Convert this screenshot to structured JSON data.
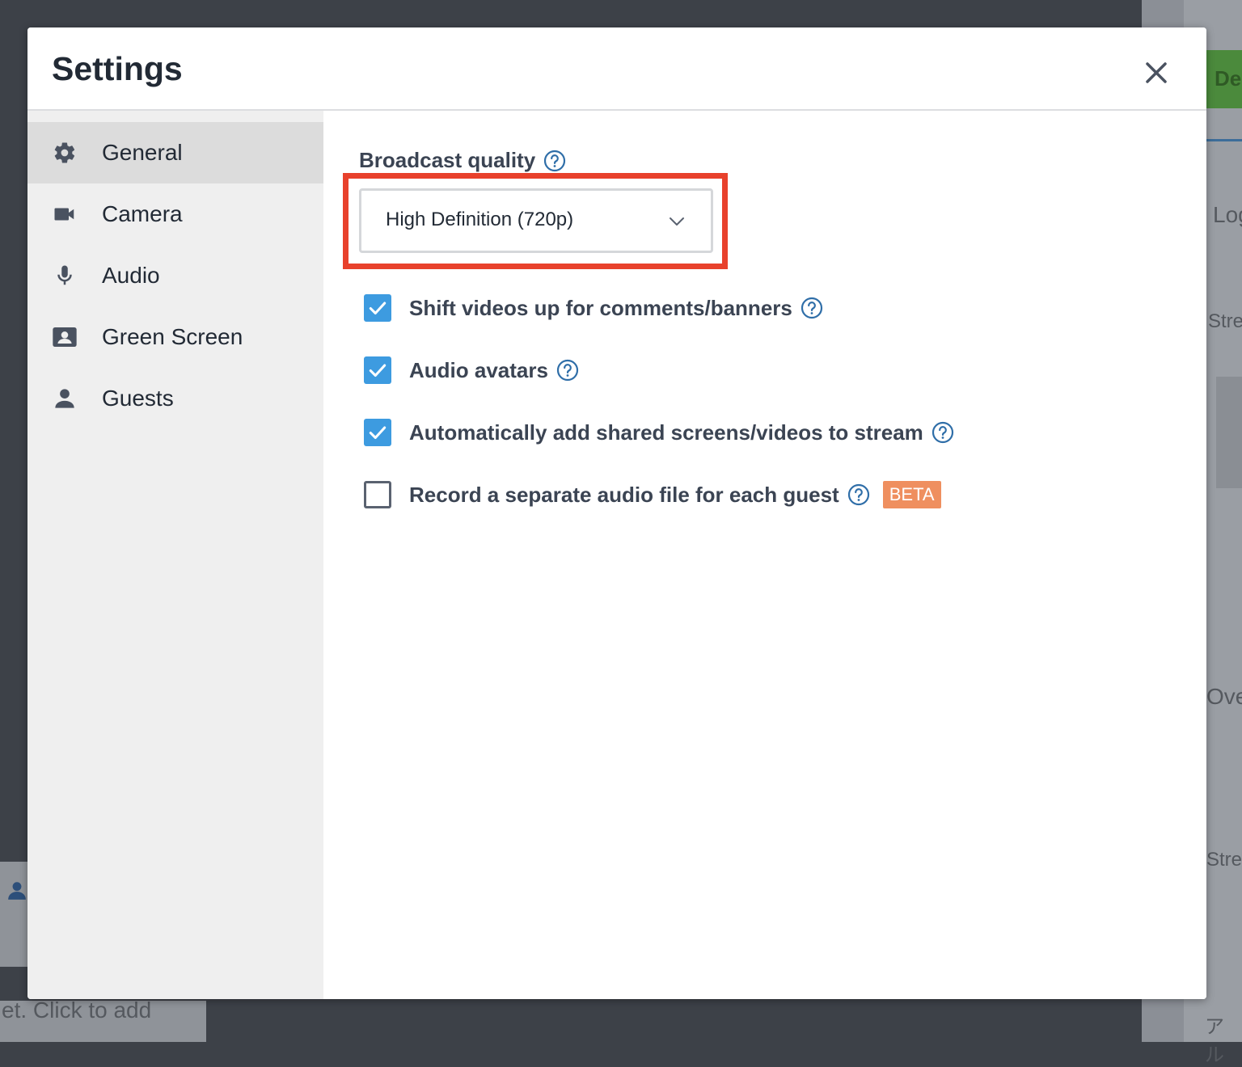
{
  "background": {
    "right_fragments": [
      "De",
      "Log",
      "Stre",
      "Ove",
      "Stre",
      "アル"
    ],
    "bottom_hint": "et. Click to add"
  },
  "modal": {
    "title": "Settings",
    "close_icon": "close-icon"
  },
  "sidebar": {
    "items": [
      {
        "label": "General",
        "icon": "gear-icon",
        "active": true
      },
      {
        "label": "Camera",
        "icon": "video-camera-icon",
        "active": false
      },
      {
        "label": "Audio",
        "icon": "microphone-icon",
        "active": false
      },
      {
        "label": "Green Screen",
        "icon": "portrait-icon",
        "active": false
      },
      {
        "label": "Guests",
        "icon": "person-icon",
        "active": false
      }
    ]
  },
  "general": {
    "broadcast_quality_label": "Broadcast quality",
    "broadcast_quality_value": "High Definition (720p)",
    "options": [
      {
        "label": "Shift videos up for comments/banners",
        "checked": true
      },
      {
        "label": "Audio avatars",
        "checked": true
      },
      {
        "label": "Automatically add shared screens/videos to stream",
        "checked": true
      },
      {
        "label": "Record a separate audio file for each guest",
        "checked": false,
        "badge": "BETA"
      }
    ]
  },
  "colors": {
    "accent": "#3d9be0",
    "highlight": "#e8412c",
    "beta_badge": "#ef8f5f",
    "help_icon": "#2f6ea8"
  }
}
